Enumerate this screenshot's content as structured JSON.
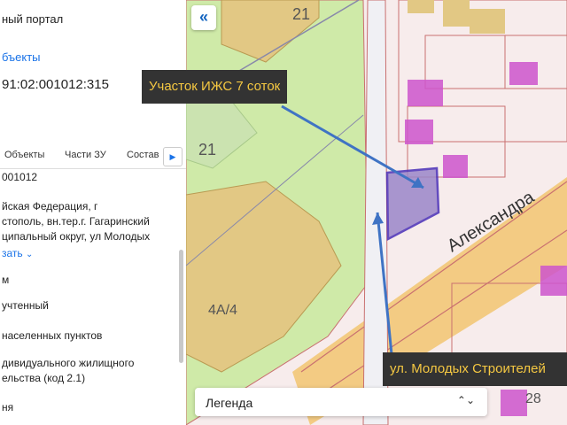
{
  "panel": {
    "portal_title": "ный портал",
    "objects_link": "бъекты",
    "cadastral_number": "91:02:001012:315",
    "tabs": [
      "Объекты",
      "Части ЗУ",
      "Состав"
    ],
    "fields": {
      "quarter": "001012",
      "address_line1": "йская Федерация, г",
      "address_line2": "стополь, вн.тер.г. Гагаринский",
      "address_line3": "ципальный округ, ул Молодых",
      "show_more": "зать",
      "area_unit": "м",
      "status": "учтенный",
      "category": "населенных пунктов",
      "use_line1": "дивидуального жилищного",
      "use_line2": "ельства (код 2.1)",
      "last": "ня"
    }
  },
  "map": {
    "street_label": "Александра",
    "numbers": {
      "n21a": "21",
      "n21b": "21",
      "n4a4": "4А/4",
      "n28": "28"
    },
    "parcel_color": "#9b87c9",
    "parcel_stroke": "#4a2fb8",
    "accent_magenta": "#cc55cc",
    "road_color": "#f2c878"
  },
  "callouts": {
    "plot": "Участок ИЖС 7 соток",
    "street": "ул. Молодых Строителей"
  },
  "legend": {
    "label": "Легенда"
  },
  "icons": {
    "back": "double-chevron-left-icon",
    "tab_next": "triangle-right-icon",
    "expand": "chevron-down-icon",
    "legend_select": "up-down-chevron-icon"
  }
}
